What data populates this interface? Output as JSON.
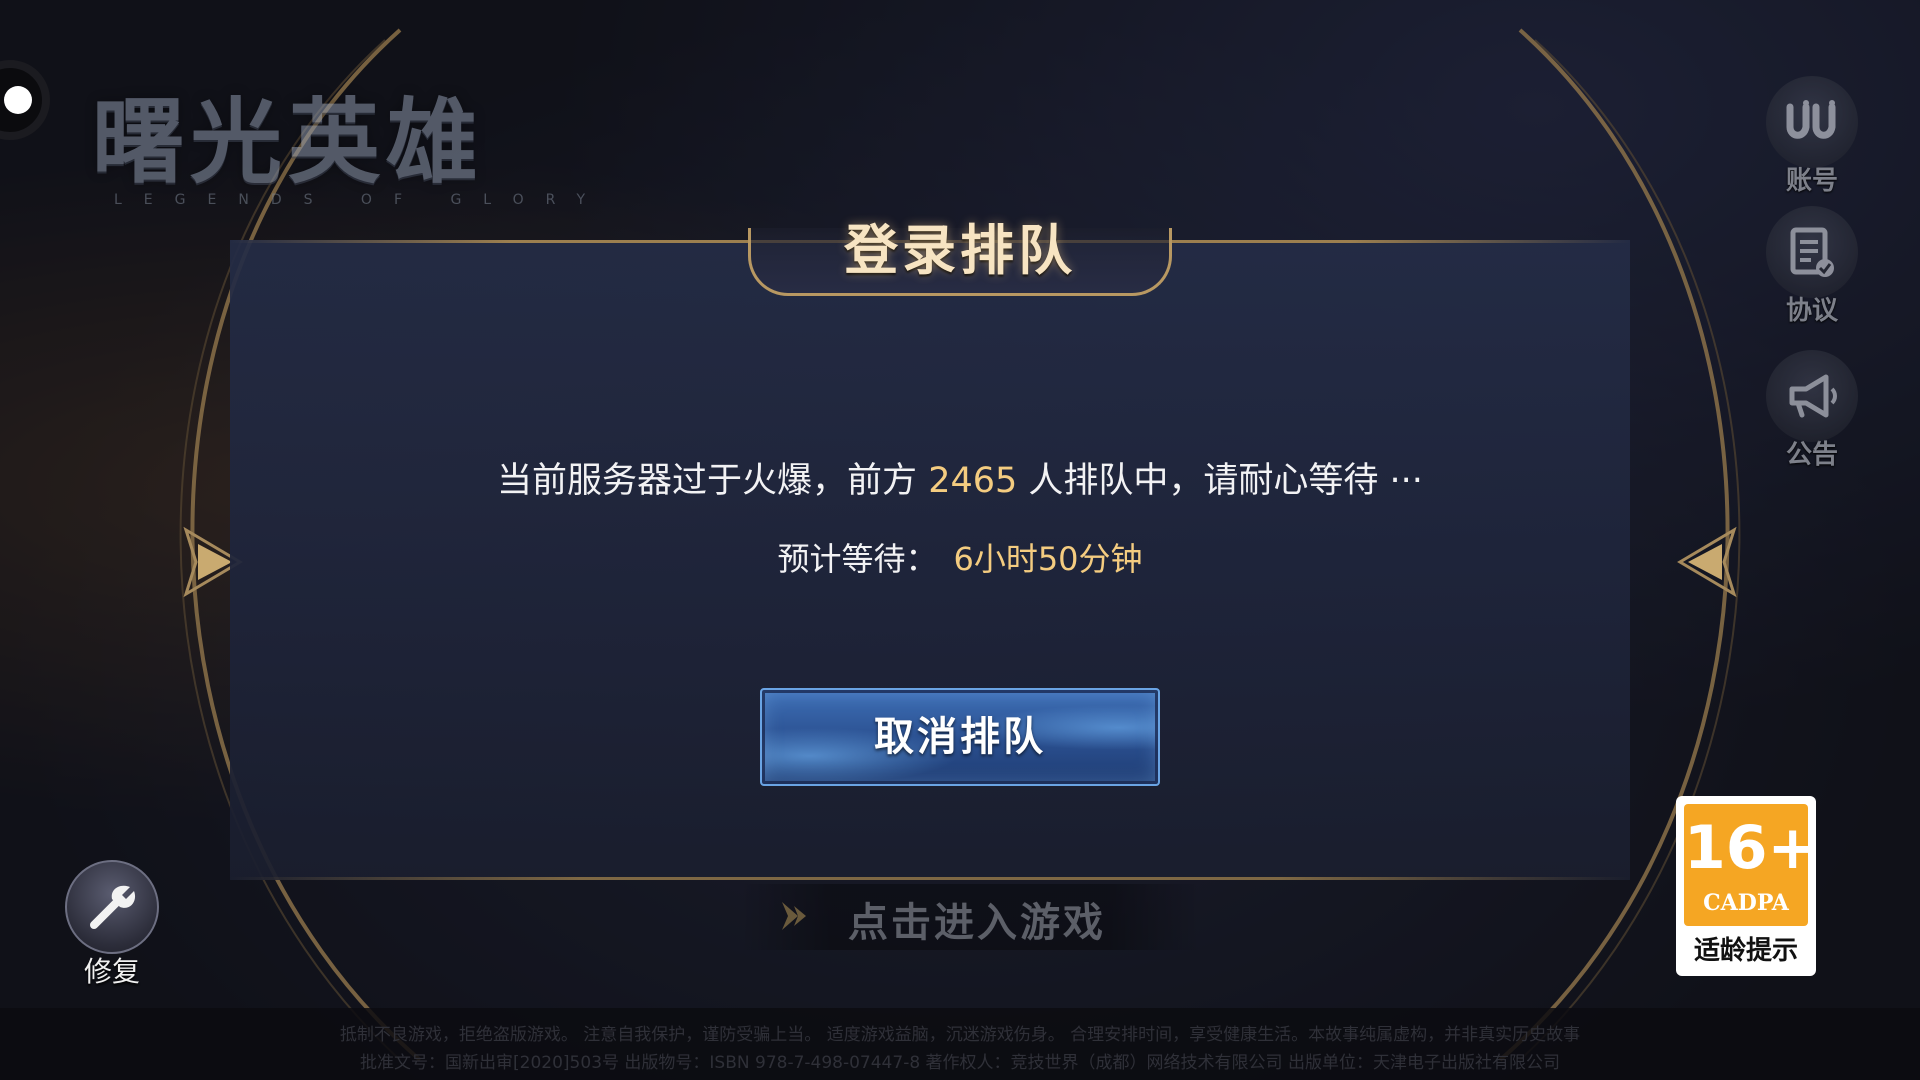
{
  "logo": {
    "title_cn": "曙光英雄",
    "title_en": "LEGENDS OF GLORY"
  },
  "dialog": {
    "title": "登录排队",
    "queue_prefix": "当前服务器过于火爆，前方",
    "queue_count": "2465",
    "queue_suffix": "人排队中，请耐心等待 ···",
    "wait_label": "预计等待：",
    "wait_time": "6小时50分钟",
    "cancel_label": "取消排队"
  },
  "enter_hint": "点击进入游戏",
  "side_buttons": {
    "account": "账号",
    "agreement": "协议",
    "notice": "公告"
  },
  "repair_label": "修复",
  "age_rating": {
    "age": "16+",
    "org": "CADPA",
    "tip": "适龄提示"
  },
  "footer": {
    "line1": "抵制不良游戏，拒绝盗版游戏。 注意自我保护，谨防受骗上当。 适度游戏益脑，沉迷游戏伤身。 合理安排时间，享受健康生活。本故事纯属虚构，并非真实历史故事",
    "line2": "批准文号：国新出审[2020]503号 出版物号：ISBN 978-7-498-07447-8 著作权人：竞技世界（成都）网络技术有限公司 出版单位：天津电子出版社有限公司"
  },
  "colors": {
    "highlight": "#f4cc80",
    "gold_frame": "#b89862",
    "button_blue": "#2a4f8f",
    "age_orange": "#f5a623"
  },
  "icons": {
    "account": "account-logo-icon",
    "agreement": "document-check-icon",
    "notice": "megaphone-icon",
    "repair": "wrench-icon",
    "enter": "double-chevron-right-icon"
  }
}
